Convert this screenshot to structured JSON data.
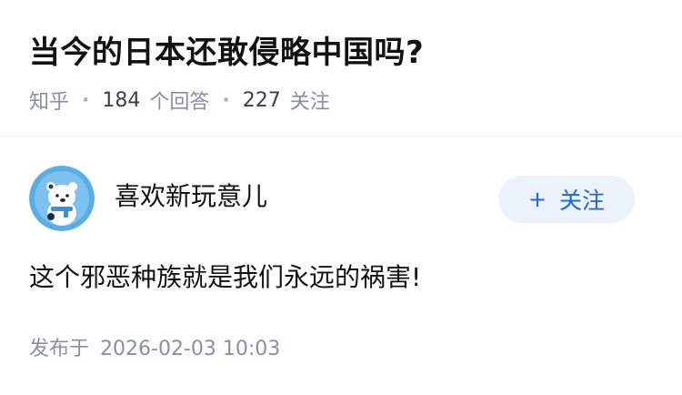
{
  "question": {
    "title": "当今的日本还敢侵略中国吗?",
    "source": "知乎",
    "answer_count": "184",
    "answer_count_label": "个回答",
    "follow_count": "227",
    "follow_count_label": "关注"
  },
  "answer": {
    "author_name": "喜欢新玩意儿",
    "follow_button_label": "关注",
    "follow_button_icon": "plus-icon",
    "content": "这个邪恶种族就是我们永远的祸害!",
    "publish_label": "发布于",
    "publish_time": "2026-02-03 10:03"
  },
  "colors": {
    "accent": "#1a66e3",
    "follow_bg": "#ebf2fb",
    "meta_text": "#8590a6",
    "avatar_bg": "#5aaee6"
  }
}
